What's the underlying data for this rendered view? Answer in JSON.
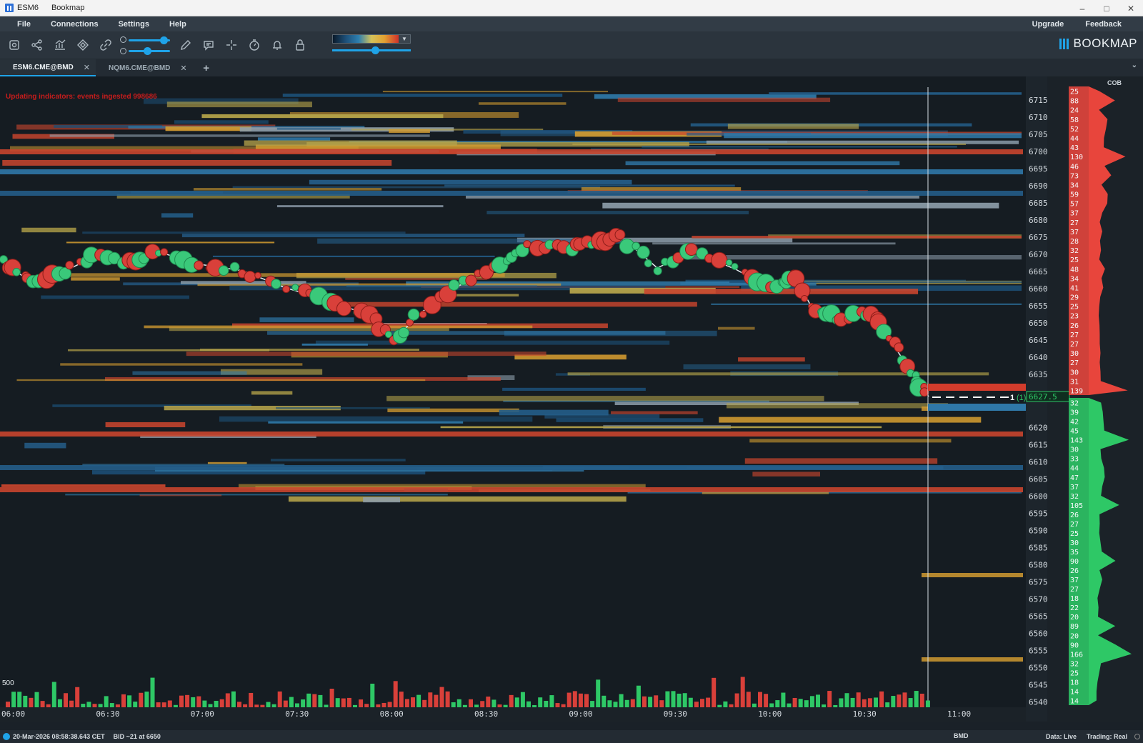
{
  "window": {
    "instrument": "ESM6",
    "app_name": "Bookmap"
  },
  "menu": {
    "file": "File",
    "connections": "Connections",
    "settings": "Settings",
    "help": "Help",
    "upgrade": "Upgrade",
    "feedback": "Feedback"
  },
  "toolbar": {
    "icons": [
      "zoom-fit-icon",
      "connections-icon",
      "indicators-icon",
      "heatmap-settings-icon",
      "link-icon",
      "drawing-icon",
      "chat-icon",
      "crosshair-icon",
      "timer-icon",
      "alerts-icon",
      "lock-icon"
    ],
    "heatmap_slider_value": 0.55,
    "contrast_slider_value": 0.85,
    "brightness_slider_value": 0.4
  },
  "brand": {
    "logo_text": "BOOKMAP",
    "accent": "#1fa3e8"
  },
  "tabs": [
    {
      "label": "ESM6.CME@BMD",
      "active": true
    },
    {
      "label": "NQM6.CME@BMD",
      "active": false
    }
  ],
  "chart": {
    "alert_text": "Updating indicators: events ingested 998686",
    "volume_scale_label": "500",
    "last_price": "6627.5",
    "last_trade_marker": "1",
    "last_trade_paren": "(1)",
    "price_ticks": [
      "6715",
      "6710",
      "6705",
      "6700",
      "6695",
      "6690",
      "6685",
      "6680",
      "6675",
      "6670",
      "6665",
      "6660",
      "6655",
      "6650",
      "6645",
      "6640",
      "6635",
      "6620",
      "6615",
      "6610",
      "6605",
      "6600",
      "6595",
      "6590",
      "6585",
      "6580",
      "6575",
      "6570",
      "6565",
      "6560",
      "6555",
      "6550",
      "6545",
      "6540"
    ],
    "time_ticks": [
      "06:00",
      "06:30",
      "07:00",
      "07:30",
      "08:00",
      "08:30",
      "09:00",
      "09:30",
      "10:00",
      "10:30",
      "11:00"
    ],
    "cob_title": "COB",
    "cob_ask": [
      "25",
      "88",
      "24",
      "58",
      "52",
      "44",
      "43",
      "130",
      "46",
      "73",
      "34",
      "59",
      "57",
      "37",
      "27",
      "37",
      "28",
      "32",
      "25",
      "48",
      "34",
      "41",
      "29",
      "25",
      "23",
      "26",
      "27",
      "27",
      "30",
      "27",
      "30",
      "31",
      "139"
    ],
    "cob_bid": [
      "32",
      "39",
      "42",
      "45",
      "143",
      "30",
      "33",
      "44",
      "47",
      "37",
      "32",
      "105",
      "26",
      "27",
      "25",
      "30",
      "35",
      "90",
      "26",
      "37",
      "27",
      "18",
      "22",
      "20",
      "89",
      "20",
      "90",
      "166",
      "32",
      "25",
      "18",
      "14",
      "14"
    ],
    "colors": {
      "ask": "#e8453c",
      "bid": "#2ec866",
      "price_line": "#2ec866"
    }
  },
  "status_bar": {
    "timestamp": "20-Mar-2026 08:58:38.643 CET",
    "bid_info": "BID ~21 at 6650",
    "feed": "BMD",
    "data_mode": "Data: Live",
    "trading_mode": "Trading: Real"
  }
}
